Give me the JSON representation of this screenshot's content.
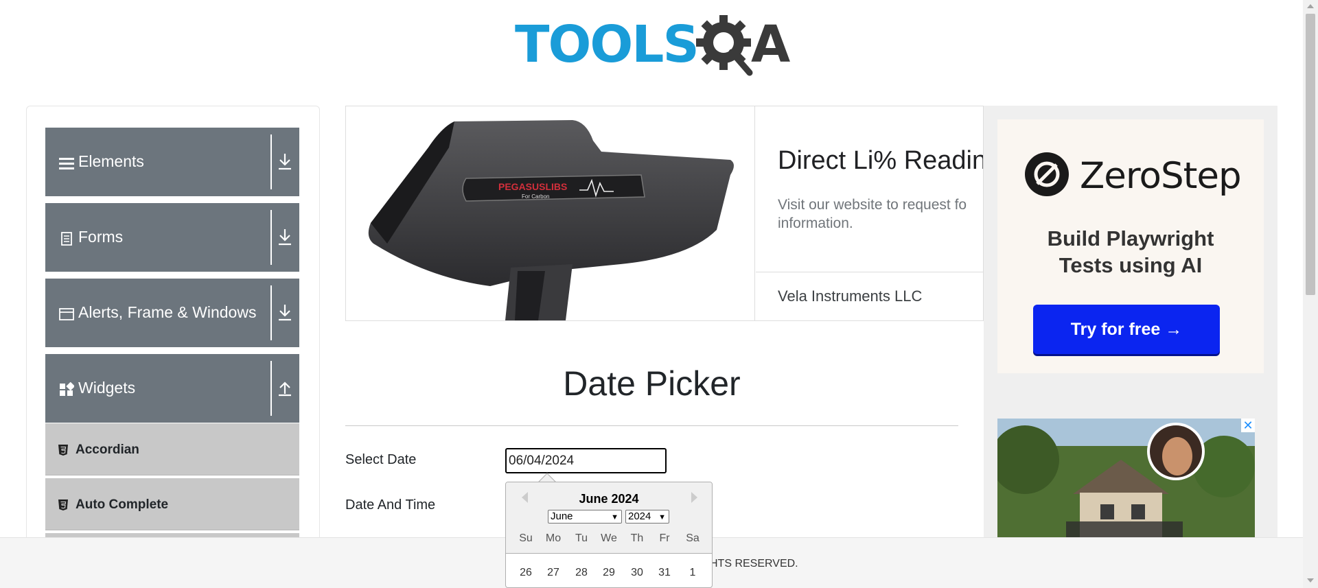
{
  "logo": {
    "text_blue": "TOOLS",
    "text_dark": "A",
    "alt": "TOOLSQA"
  },
  "sidebar": {
    "groups": [
      {
        "label": "Elements",
        "icon": "hamburger-icon",
        "arrow": "download-arrow-icon"
      },
      {
        "label": "Forms",
        "icon": "document-icon",
        "arrow": "download-arrow-icon"
      },
      {
        "label": "Alerts, Frame & Windows",
        "icon": "window-icon",
        "arrow": "download-arrow-icon"
      },
      {
        "label": "Widgets",
        "icon": "widgets-icon",
        "arrow": "upload-arrow-icon"
      }
    ],
    "items": [
      {
        "label": "Accordian",
        "icon": "html5-icon"
      },
      {
        "label": "Auto Complete",
        "icon": "html5-icon"
      }
    ]
  },
  "ad_top": {
    "product_text": "PEGASUSLIBS",
    "product_sub": "For Carbon",
    "title": "Direct Li% Reading",
    "description": "Visit our website to request fo information.",
    "brand": "Vela Instruments LLC"
  },
  "ad_right": {
    "brand": "ZeroStep",
    "headline_line1": "Build Playwright",
    "headline_line2": "Tests using AI",
    "cta": "Try for free →",
    "close_glyph": "✕"
  },
  "main": {
    "title": "Date Picker",
    "select_date_label": "Select Date",
    "select_date_value": "06/04/2024",
    "date_time_label": "Date And Time"
  },
  "datepicker": {
    "current_month": "June 2024",
    "month_select": "June",
    "year_select": "2024",
    "day_names": [
      "Su",
      "Mo",
      "Tu",
      "We",
      "Th",
      "Fr",
      "Sa"
    ],
    "first_week": [
      "26",
      "27",
      "28",
      "29",
      "30",
      "31",
      "1"
    ]
  },
  "footer": {
    "text": "HTS RESERVED."
  },
  "colors": {
    "sidebar_group": "#6c757d",
    "logo_blue": "#1a9cd8",
    "cta_blue": "#0b25f0"
  }
}
